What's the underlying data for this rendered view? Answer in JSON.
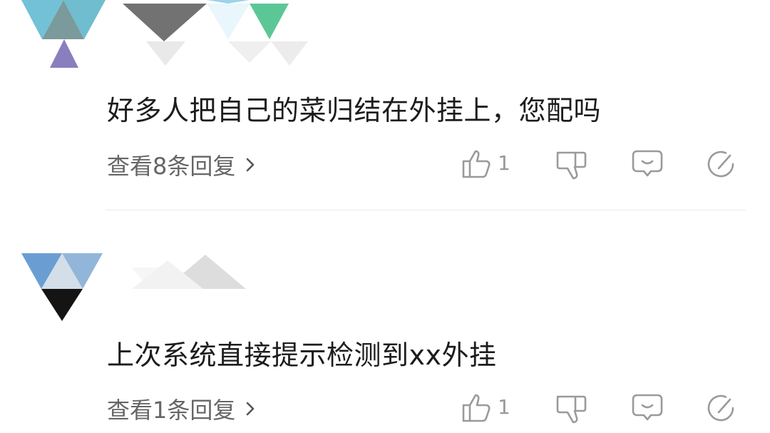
{
  "colors": {
    "text_primary": "#1c1c1c",
    "text_secondary": "#666666",
    "icon_gray": "#9a9a9a",
    "divider": "#ececec"
  },
  "comments": [
    {
      "text": "好多人把自己的菜归结在外挂上，您配吗",
      "view_replies": "查看8条回复",
      "like_count": "1",
      "icons": [
        "thumbs-up-icon",
        "thumbs-down-icon",
        "comment-icon",
        "share-icon"
      ]
    },
    {
      "text": "上次系统直接提示检测到xx外挂",
      "view_replies": "查看1条回复",
      "like_count": "1",
      "icons": [
        "thumbs-up-icon",
        "thumbs-down-icon",
        "comment-icon",
        "share-icon"
      ]
    }
  ]
}
